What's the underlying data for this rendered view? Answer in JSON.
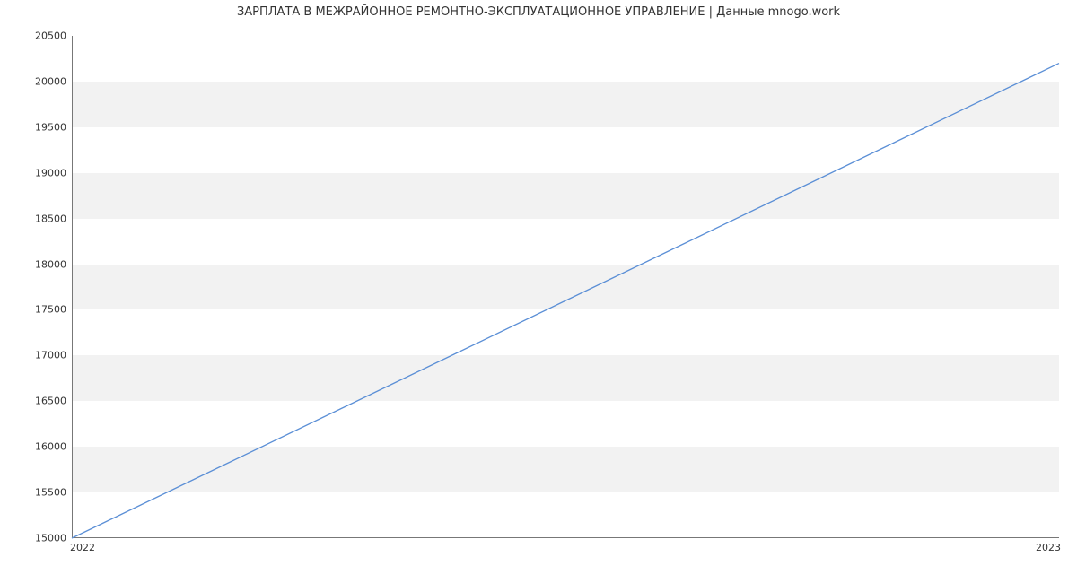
{
  "chart_data": {
    "type": "line",
    "title": "ЗАРПЛАТА В  МЕЖРАЙОННОЕ РЕМОНТНО-ЭКСПЛУАТАЦИОННОЕ УПРАВЛЕНИЕ | Данные mnogo.work",
    "xlabel": "",
    "ylabel": "",
    "x": [
      "2022",
      "2023"
    ],
    "values": [
      15000,
      20200
    ],
    "y_ticks": [
      15000,
      15500,
      16000,
      16500,
      17000,
      17500,
      18000,
      18500,
      19000,
      19500,
      20000,
      20500
    ],
    "x_ticks": [
      "2022",
      "2023"
    ],
    "ylim": [
      15000,
      20500
    ],
    "line_color": "#5b8fd6",
    "band_color": "#f2f2f2"
  }
}
